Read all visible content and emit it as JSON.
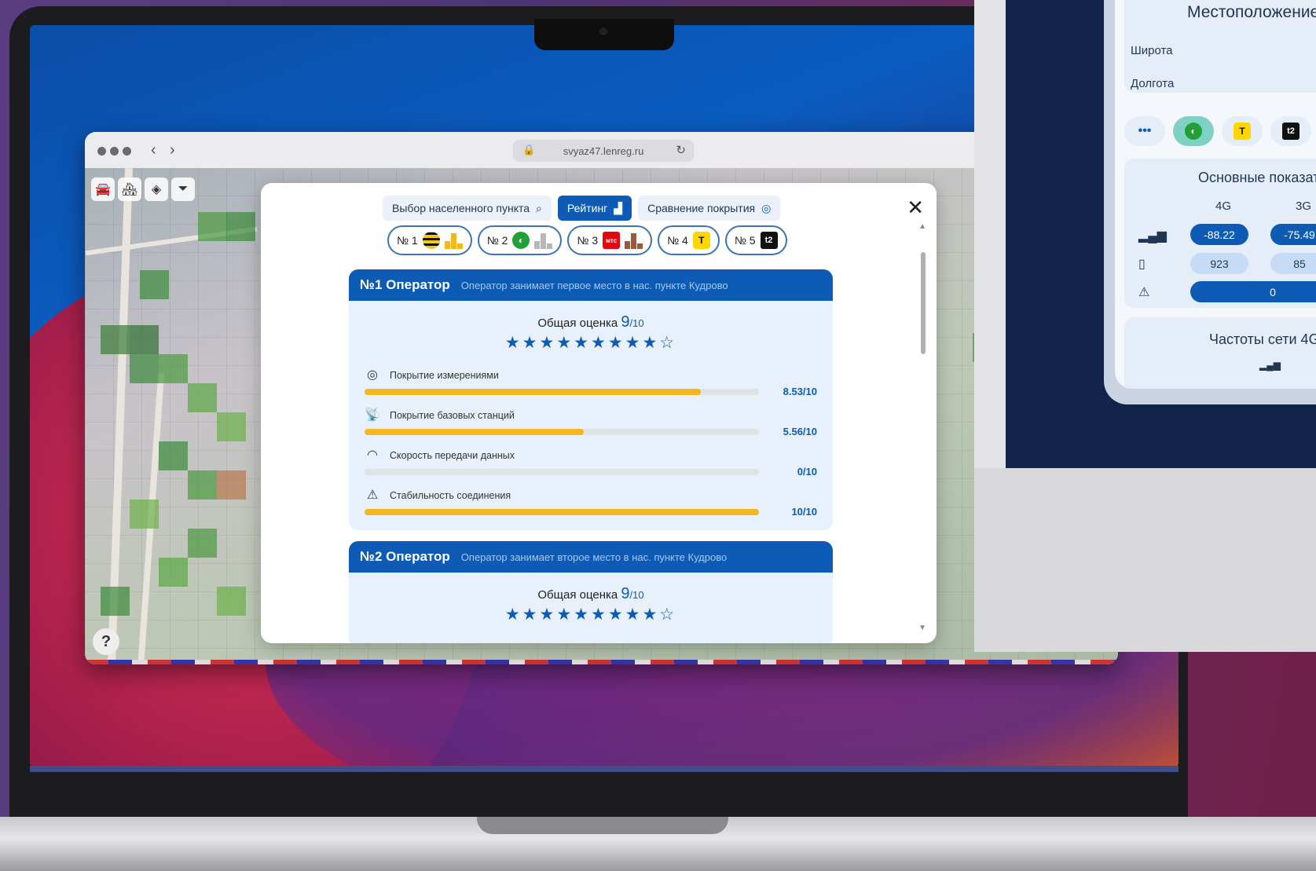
{
  "browser": {
    "url": "svyaz47.lenreg.ru"
  },
  "modal": {
    "tabs": [
      {
        "label": "Выбор населенного пункта",
        "icon": "search-icon"
      },
      {
        "label": "Рейтинг",
        "icon": "ranking-icon"
      },
      {
        "label": "Сравнение покрытия",
        "icon": "coverage-icon"
      }
    ],
    "chips": [
      {
        "label": "№ 1",
        "logo_color": "#f5c518"
      },
      {
        "label": "№ 2",
        "logo_color": "#21a038"
      },
      {
        "label": "№ 3",
        "logo_color": "#e30611"
      },
      {
        "label": "№ 4",
        "logo_color": "#ffd600"
      },
      {
        "label": "№ 5",
        "logo_color": "#000000"
      }
    ],
    "cards": [
      {
        "title": "№1 Оператор",
        "subtitle": "Оператор занимает первое место в нас. пункте Кудрово",
        "overall_label": "Общая оценка",
        "score": "9",
        "score_max": "/10",
        "stars": "★★★★★★★★★☆",
        "metrics": [
          {
            "label": "Покрытие измерениями",
            "value": "8.53/10",
            "fraction": 0.853
          },
          {
            "label": "Покрытие базовых станций",
            "value": "5.56/10",
            "fraction": 0.556
          },
          {
            "label": "Скорость передачи данных",
            "value": "0/10",
            "fraction": 0
          },
          {
            "label": "Стабильность соединения",
            "value": "10/10",
            "fraction": 1
          }
        ]
      },
      {
        "title": "№2 Оператор",
        "subtitle": "Оператор занимает второе место в нас. пункте Кудрово",
        "overall_label": "Общая оценка",
        "score": "9",
        "score_max": "/10",
        "stars": "★★★★★★★★★☆"
      }
    ]
  },
  "phone": {
    "location_title": "Местоположение",
    "latitude_label": "Широта",
    "longitude_label": "Долгота",
    "metrics_title": "Основные показатели",
    "col_4g": "4G",
    "col_3g": "3G",
    "signal_4g": "-88.22",
    "signal_3g": "-75.49",
    "devices_4g": "923",
    "devices_3g": "85",
    "errors": "0",
    "freq_title": "Частоты сети 4G"
  },
  "colors": {
    "accent": "#0d5bb5",
    "progress": "#f3b71f"
  }
}
